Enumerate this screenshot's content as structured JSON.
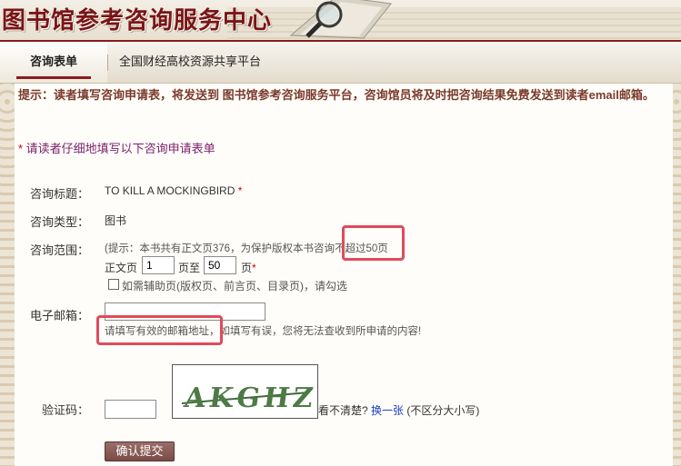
{
  "header": {
    "site_title": "图书馆参考咨询服务中心"
  },
  "nav": {
    "tabs": [
      {
        "label": "咨询表单"
      },
      {
        "label": "全国财经高校资源共享平台"
      }
    ]
  },
  "notice": "提示：读者填写咨询申请表，将发送到 图书馆参考咨询服务平台，咨询馆员将及时把咨询结果免费发送到读者email邮箱。",
  "required_note": {
    "star": "*",
    "text": " 请读者仔细地填写以下咨询申请表单"
  },
  "form": {
    "title_label": "咨询标题：",
    "title_value": "TO KILL A MOCKINGBIRD",
    "required_star": "*",
    "type_label": "咨询类型：",
    "type_value": "图书",
    "scope_label": "咨询范围：",
    "scope_hint": "(提示：本书共有正文页376，为保护版权本书咨询不超过50页",
    "page_label": "正文页",
    "page_from": "1",
    "page_to_label": "页至",
    "page_to": "50",
    "page_unit": "页",
    "aux_pages_label": "如需辅助页(版权页、前言页、目录页)，请勾选",
    "email_label": "电子邮箱：",
    "email_value": "",
    "email_hint": "请填写有效的邮箱地址，如填写有误，您将无法查收到所申请的内容!",
    "captcha_label": "验证码：",
    "captcha_value": "",
    "captcha_text": "AKGHZ",
    "captcha_unclear": "看不清楚?",
    "captcha_refresh": "换一张",
    "captcha_case": "(不区分大小写)",
    "submit_label": "确认提交"
  },
  "colors": {
    "brand": "#7a1416",
    "highlight": "#e24a5a",
    "link": "#1b3fbf"
  }
}
